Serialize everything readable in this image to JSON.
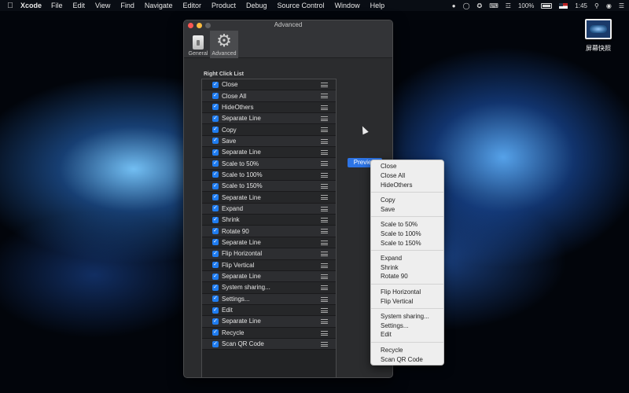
{
  "menubar": {
    "apple": "",
    "app_name": "Xcode",
    "menus": [
      "File",
      "Edit",
      "View",
      "Find",
      "Navigate",
      "Editor",
      "Product",
      "Debug",
      "Source Control",
      "Window",
      "Help"
    ],
    "battery_text": "100%",
    "time": "1:45"
  },
  "desktop": {
    "icon_label": "屏幕快照"
  },
  "window": {
    "title": "Advanced",
    "tabs": [
      {
        "label": "General",
        "icon": "general-switch-icon"
      },
      {
        "label": "Advanced",
        "icon": "gear-icon"
      }
    ],
    "group_label": "Right Click List",
    "list": [
      "Close",
      "Close All",
      "HideOthers",
      "Separate Line",
      "Copy",
      "Save",
      "Separate Line",
      "Scale to 50%",
      "Scale to 100%",
      "Scale to 150%",
      "Separate Line",
      "Expand",
      "Shrink",
      "Rotate 90",
      "Separate Line",
      "Flip Horizontal",
      "Flip Vertical",
      "Separate Line",
      "System sharing...",
      "Settings...",
      "Edit",
      "Separate Line",
      "Recycle",
      "Scan QR Code"
    ],
    "preview_label": "Preview"
  },
  "context_menu": {
    "items": [
      {
        "label": "Close"
      },
      {
        "label": "Close All"
      },
      {
        "label": "HideOthers"
      },
      {
        "sep": true
      },
      {
        "label": "Copy"
      },
      {
        "label": "Save"
      },
      {
        "sep": true
      },
      {
        "label": "Scale to 50%"
      },
      {
        "label": "Scale to 100%"
      },
      {
        "label": "Scale to 150%"
      },
      {
        "sep": true
      },
      {
        "label": "Expand"
      },
      {
        "label": "Shrink"
      },
      {
        "label": "Rotate 90"
      },
      {
        "sep": true
      },
      {
        "label": "Flip Horizontal"
      },
      {
        "label": "Flip Vertical"
      },
      {
        "sep": true
      },
      {
        "label": "System sharing..."
      },
      {
        "label": "Settings..."
      },
      {
        "label": "Edit"
      },
      {
        "sep": true
      },
      {
        "label": "Recycle"
      },
      {
        "label": "Scan QR Code"
      }
    ]
  },
  "colors": {
    "accent": "#1f7cf0",
    "window_bg": "#2b2c2e",
    "menu_bg": "#eeeeee"
  }
}
